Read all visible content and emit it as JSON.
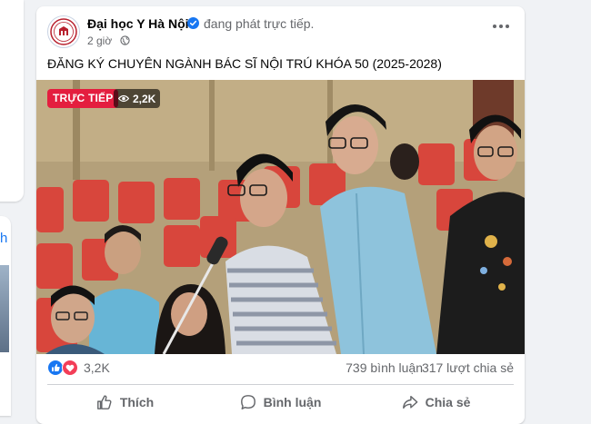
{
  "left_panel": {
    "partial_letter": "h"
  },
  "post": {
    "page_name": "Đại học Y Hà Nội",
    "status": "đang phát trực tiếp.",
    "time": "2 giờ",
    "text": "ĐĂNG KÝ CHUYÊN NGÀNH BÁC SĨ NỘI TRÚ KHÓA 50 (2025-2028)",
    "live_badge": "TRỰC TIẾP",
    "viewer_count": "2,2K",
    "reaction_count": "3,2K",
    "comment_count": "739 bình luận",
    "share_count": "317 lượt chia sẻ"
  },
  "actions": {
    "like": "Thích",
    "comment": "Bình luận",
    "share": "Chia sẻ"
  },
  "colors": {
    "live_red": "#e41e3f",
    "verified_blue": "#1877f2",
    "like_blue": "#1877f2",
    "love_red": "#f33e58"
  }
}
